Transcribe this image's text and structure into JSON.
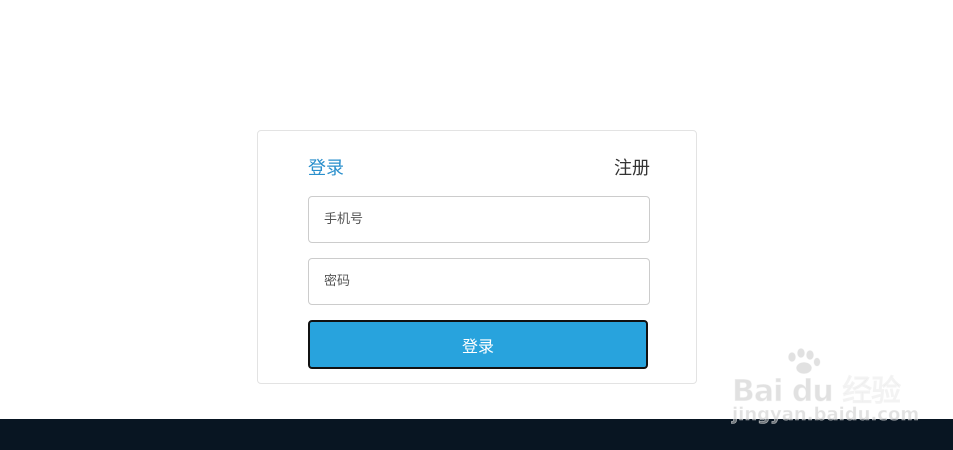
{
  "login_form": {
    "tabs": {
      "login_label": "登录",
      "register_label": "注册"
    },
    "phone_field": {
      "placeholder": "手机号",
      "value": ""
    },
    "password_field": {
      "placeholder": "密码",
      "value": ""
    },
    "submit_label": "登录"
  },
  "watermark": {
    "brand": "Bai du 经验",
    "url": "jingyan.baidu.com"
  },
  "colors": {
    "accent": "#2a8fcc",
    "button": "#28a3dd",
    "footer": "#081522"
  }
}
